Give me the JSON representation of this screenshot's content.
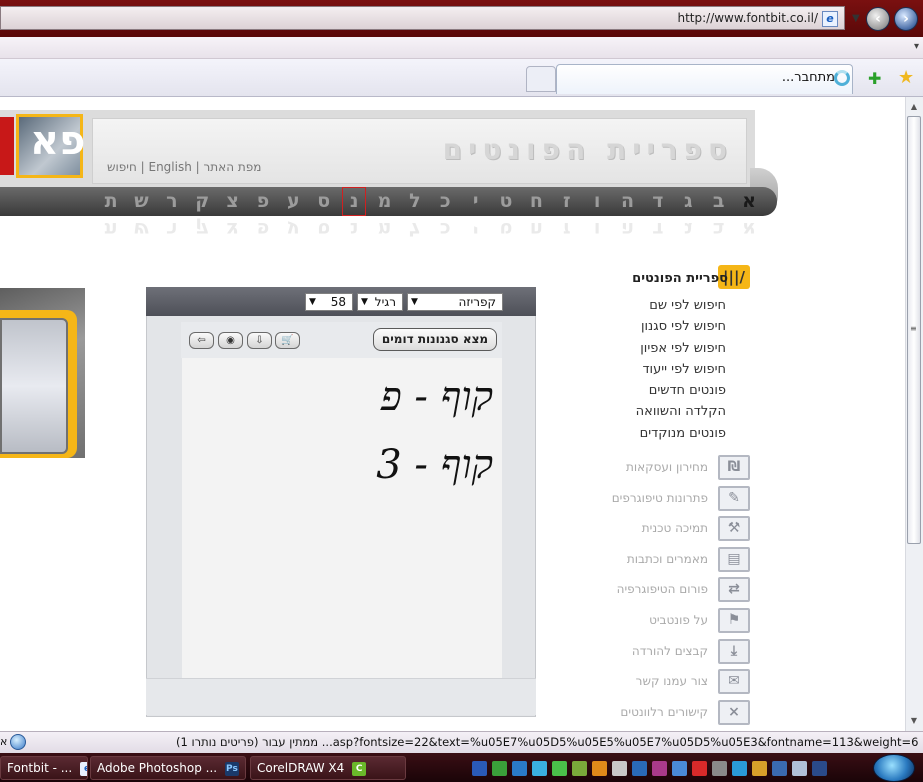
{
  "browser": {
    "url": "http://www.fontbit.co.il/",
    "tab_label": "מתחבר...",
    "status_text": "(1 פריטים נותרו) ממתין עבור ...asp?fontsize=22&text=%u05E7%u05D5%u05E5%u05E7%u05D5%u05E3&fontname=113&weight=6"
  },
  "site": {
    "title": "ספריית הפונטים",
    "top_links": [
      "מפת האתר",
      "English",
      "חיפוש"
    ],
    "logo_glyph": "פא"
  },
  "alphabet": {
    "letters": [
      "א",
      "ב",
      "ג",
      "ד",
      "ה",
      "ו",
      "ז",
      "ח",
      "ט",
      "י",
      "כ",
      "ל",
      "מ",
      "נ",
      "ס",
      "ע",
      "פ",
      "צ",
      "ק",
      "ר",
      "ש",
      "ת"
    ],
    "selected": "נ"
  },
  "sidebar": {
    "heading": "ספריית הפונטים",
    "links": [
      "חיפוש לפי שם",
      "חיפוש לפי סגנון",
      "חיפוש לפי אפיון",
      "חיפוש לפי ייעוד",
      "פונטים חדשים",
      "הקלדה והשוואה",
      "פונטים מנוקדים"
    ],
    "sections": [
      {
        "label": "מחירון ועסקאות",
        "icon": "price-icon"
      },
      {
        "label": "פתרונות טיפוגרפים",
        "icon": "pen-icon"
      },
      {
        "label": "תמיכה טכנית",
        "icon": "wrench-icon"
      },
      {
        "label": "מאמרים וכתבות",
        "icon": "book-icon"
      },
      {
        "label": "פורום הטיפוגרפיה",
        "icon": "forum-icon"
      },
      {
        "label": "על פונטביט",
        "icon": "flag-icon"
      },
      {
        "label": "קבצים להורדה",
        "icon": "download-icon"
      },
      {
        "label": "צור עמנו קשר",
        "icon": "mail-icon"
      },
      {
        "label": "קישורים רלוונטים",
        "icon": "links-icon"
      }
    ]
  },
  "panel": {
    "font_select": "קפריזה",
    "weight_select": "רגיל",
    "size_select": "58",
    "find_similar_label": "מצא סגנונות דומים",
    "preview_lines": [
      "קוף - פ",
      "קוף - 3"
    ]
  },
  "taskbar": {
    "tasks": [
      "Fontbit - ...",
      "Adobe Photoshop ...",
      "CorelDRAW X4"
    ]
  }
}
